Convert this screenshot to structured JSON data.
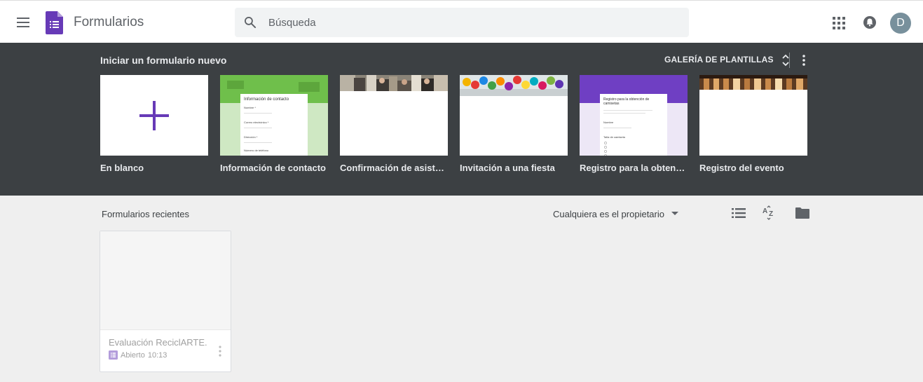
{
  "header": {
    "app_title": "Formularios",
    "search_placeholder": "Búsqueda",
    "avatar_letter": "D"
  },
  "templates": {
    "section_title": "Iniciar un formulario nuevo",
    "gallery_label": "GALERÍA DE PLANTILLAS",
    "items": [
      {
        "label": "En blanco"
      },
      {
        "label": "Información de contacto",
        "preview_title": "Información de contacto",
        "preview_fields": [
          "Nombre *",
          "Correo electrónico *",
          "Dirección *",
          "Número de teléfono"
        ]
      },
      {
        "label": "Confirmación de asistencia"
      },
      {
        "label": "Invitación a una fiesta"
      },
      {
        "label": "Registro para la obtención de camisetas",
        "preview_title": "Registro para la obtención de camisetas",
        "preview_fields": [
          "Nombre",
          "Talla de camiseta"
        ]
      },
      {
        "label": "Registro del evento"
      }
    ]
  },
  "recent": {
    "section_title": "Formularios recientes",
    "owner_filter": "Cualquiera es el propietario",
    "items": [
      {
        "name": "Evaluación ReciclARTE.",
        "status": "Abierto",
        "time": "10:13"
      }
    ]
  },
  "colors": {
    "brand_purple": "#673ab7",
    "band_bg": "#3c4043",
    "contact_green": "#6fbf4b",
    "shirt_purple": "#6f3fc3"
  }
}
